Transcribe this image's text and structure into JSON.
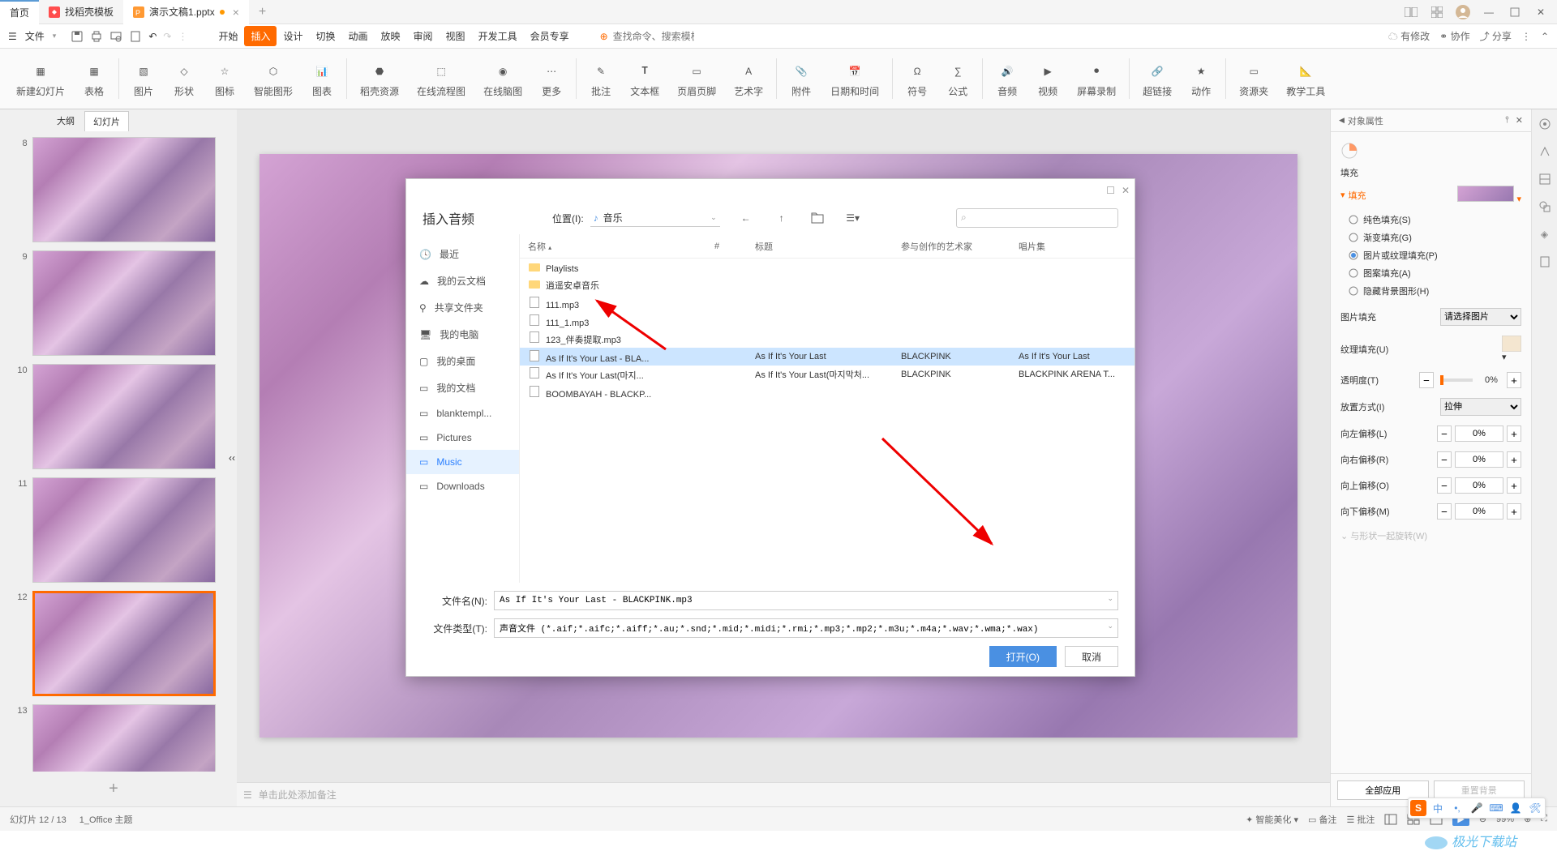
{
  "tabs": {
    "home": "首页",
    "templates": "找稻壳模板",
    "doc": "演示文稿1.pptx"
  },
  "menubar": {
    "file": "文件",
    "items": [
      "开始",
      "插入",
      "设计",
      "切换",
      "动画",
      "放映",
      "审阅",
      "视图",
      "开发工具",
      "会员专享"
    ],
    "active_index": 1,
    "search_placeholder": "查找命令、搜索模板",
    "right": {
      "changes": "有修改",
      "coop": "协作",
      "share": "分享"
    }
  },
  "ribbon": [
    "新建幻灯片",
    "表格",
    "图片",
    "形状",
    "图标",
    "智能图形",
    "图表",
    "稻壳资源",
    "在线流程图",
    "在线脑图",
    "更多",
    "批注",
    "文本框",
    "页眉页脚",
    "艺术字",
    "附件",
    "日期和时间",
    "符号",
    "公式",
    "音频",
    "视频",
    "屏幕录制",
    "超链接",
    "动作",
    "资源夹",
    "教学工具"
  ],
  "slide_tabs": {
    "outline": "大纲",
    "slides": "幻灯片"
  },
  "thumbs": [
    8,
    9,
    10,
    11,
    12,
    13
  ],
  "selected_thumb": 12,
  "notes_placeholder": "单击此处添加备注",
  "dialog": {
    "title": "插入音频",
    "loc_label": "位置(I):",
    "loc_value": "音乐",
    "columns": {
      "name": "名称",
      "num": "#",
      "title": "标题",
      "artist": "参与创作的艺术家",
      "album": "唱片集"
    },
    "sidebar": [
      {
        "icon": "clock",
        "label": "最近"
      },
      {
        "icon": "cloud",
        "label": "我的云文档"
      },
      {
        "icon": "share",
        "label": "共享文件夹"
      },
      {
        "icon": "pc",
        "label": "我的电脑"
      },
      {
        "icon": "desktop",
        "label": "我的桌面"
      },
      {
        "icon": "docs",
        "label": "我的文档"
      },
      {
        "icon": "folder",
        "label": "blanktempl..."
      },
      {
        "icon": "folder",
        "label": "Pictures"
      },
      {
        "icon": "folder",
        "label": "Music"
      },
      {
        "icon": "folder",
        "label": "Downloads"
      }
    ],
    "sidebar_active": 8,
    "files": [
      {
        "type": "folder",
        "name": "Playlists"
      },
      {
        "type": "folder",
        "name": "逍遥安卓音乐"
      },
      {
        "type": "file",
        "name": "111.mp3"
      },
      {
        "type": "file",
        "name": "111_1.mp3"
      },
      {
        "type": "file",
        "name": "123_伴奏提取.mp3"
      },
      {
        "type": "file",
        "name": "As If It's Your Last - BLA...",
        "title": "As If It's Your Last",
        "artist": "BLACKPINK",
        "album": "As If It's Your Last",
        "selected": true
      },
      {
        "type": "file",
        "name": "As If It's Your Last(마지...",
        "title": "As If It's Your Last(마지막처...",
        "artist": "BLACKPINK",
        "album": "BLACKPINK ARENA T..."
      },
      {
        "type": "file",
        "name": "BOOMBAYAH - BLACKP..."
      }
    ],
    "filename_label": "文件名(N):",
    "filename_value": "As If It's Your Last - BLACKPINK.mp3",
    "filetype_label": "文件类型(T):",
    "filetype_value": "声音文件 (*.aif;*.aifc;*.aiff;*.au;*.snd;*.mid;*.midi;*.rmi;*.mp3;*.mp2;*.m3u;*.m4a;*.wav;*.wma;*.wax)",
    "open_btn": "打开(O)",
    "cancel_btn": "取消"
  },
  "panel": {
    "title": "对象属性",
    "section": "填充",
    "collapsible": "填充",
    "fill_options": [
      "纯色填充(S)",
      "渐变填充(G)",
      "图片或纹理填充(P)",
      "图案填充(A)",
      "隐藏背景图形(H)"
    ],
    "fill_selected": 2,
    "pic_fill": "图片填充",
    "pic_fill_val": "请选择图片",
    "texture": "纹理填充(U)",
    "opacity": "透明度(T)",
    "opacity_val": "0%",
    "tile": "放置方式(I)",
    "tile_val": "拉伸",
    "offsets": [
      {
        "label": "向左偏移(L)",
        "val": "0%"
      },
      {
        "label": "向右偏移(R)",
        "val": "0%"
      },
      {
        "label": "向上偏移(O)",
        "val": "0%"
      },
      {
        "label": "向下偏移(M)",
        "val": "0%"
      }
    ],
    "rotate": "与形状一起旋转(W)",
    "apply_all": "全部应用",
    "reset_bg": "重置背景"
  },
  "status": {
    "slide_count": "幻灯片 12 / 13",
    "theme": "1_Office 主题",
    "beautify": "智能美化",
    "notes": "备注",
    "comments": "批注",
    "zoom": "99%"
  },
  "watermark": "极光下载站"
}
